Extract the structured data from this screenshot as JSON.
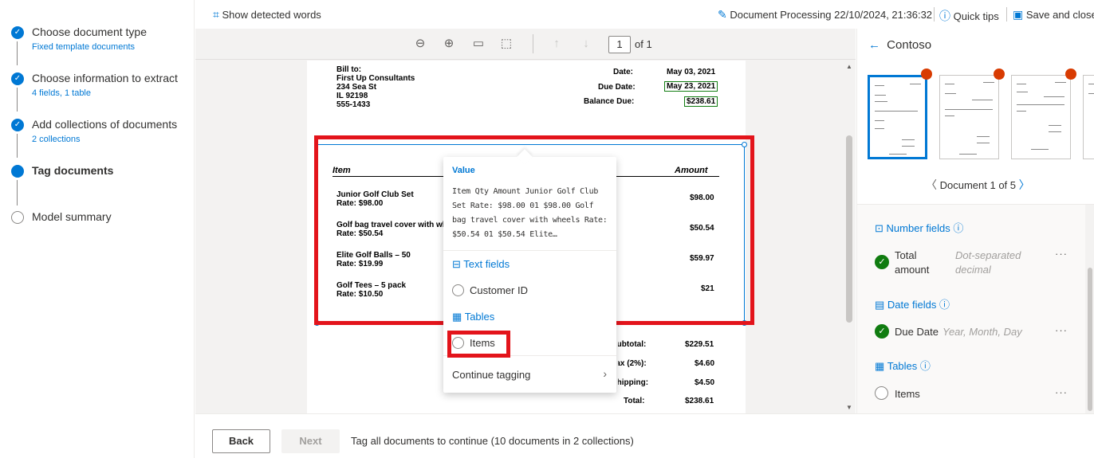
{
  "steps": [
    {
      "title": "Choose document type",
      "sub": "Fixed template documents",
      "state": "done"
    },
    {
      "title": "Choose information to extract",
      "sub": "4 fields, 1 table",
      "state": "done"
    },
    {
      "title": "Add collections of documents",
      "sub": "2 collections",
      "state": "done"
    },
    {
      "title": "Tag documents",
      "sub": "",
      "state": "current"
    },
    {
      "title": "Model summary",
      "sub": "",
      "state": "todo"
    }
  ],
  "topbar": {
    "show_words": "Show detected words",
    "doc_processing": "Document Processing 22/10/2024, 21:36:32",
    "quick_tips": "Quick tips",
    "save_close": "Save and close"
  },
  "viewer": {
    "page_current": "1",
    "page_of": "of 1"
  },
  "document": {
    "bill_to_lines": [
      "Bill to:",
      "First Up Consultants",
      "234 Sea St",
      "IL 92198",
      "555-1433"
    ],
    "date_label": "Date:",
    "date_value": "May 03, 2021",
    "due_label": "Due Date:",
    "due_value": "May 23, 2021",
    "balance_label": "Balance Due:",
    "balance_value": "$238.61",
    "col_item": "Item",
    "col_amount": "Amount",
    "items": [
      {
        "name": "Junior Golf Club Set",
        "rate": "Rate: $98.00",
        "amount": "$98.00"
      },
      {
        "name": "Golf bag travel cover with whee",
        "rate": "Rate: $50.54",
        "amount": "$50.54"
      },
      {
        "name": "Elite Golf Balls – 50",
        "rate": "Rate: $19.99",
        "amount": "$59.97"
      },
      {
        "name": "Golf Tees – 5 pack",
        "rate": "Rate: $10.50",
        "amount": "$21"
      }
    ],
    "totals": [
      {
        "label": "Subtotal:",
        "value": "$229.51"
      },
      {
        "label": "Tax (2%):",
        "value": "$4.60"
      },
      {
        "label": "Shipping:",
        "value": "$4.50"
      },
      {
        "label": "Total:",
        "value": "$238.61"
      }
    ]
  },
  "popup": {
    "value_label": "Value",
    "value_text": "Item Qty Amount Junior Golf Club Set Rate: $98.00 01 $98.00 Golf bag travel cover with wheels Rate: $50.54 01 $50.54 Elite…",
    "text_fields": "Text fields",
    "customer_id": "Customer ID",
    "tables": "Tables",
    "items": "Items",
    "continue": "Continue tagging"
  },
  "right_panel": {
    "back_title": "Contoso",
    "doc_nav": "Document 1 of 5",
    "number_fields": "Number fields",
    "total_amount": "Total amount",
    "total_amount_type": "Dot-separated decimal",
    "date_fields": "Date fields",
    "due_date": "Due Date",
    "due_date_type": "Year, Month, Day",
    "tables": "Tables",
    "items": "Items"
  },
  "footer": {
    "back": "Back",
    "next": "Next",
    "message": "Tag all documents to continue (10 documents in 2 collections)"
  },
  "colors": {
    "accent": "#0078d4",
    "tag_red": "#e3141b",
    "success": "#107c10",
    "dot_orange": "#d83b01"
  },
  "icons": [
    "show-words-icon",
    "pencil-icon",
    "help-icon",
    "save-icon",
    "zoom-out-icon",
    "zoom-in-icon",
    "fit-width-icon",
    "fit-page-icon",
    "arrow-up-icon",
    "arrow-down-icon",
    "back-arrow-icon",
    "chevron-left-icon",
    "chevron-right-icon",
    "number-icon",
    "info-icon",
    "calendar-icon",
    "table-icon",
    "text-field-icon",
    "checkmark-icon",
    "more-icon"
  ]
}
